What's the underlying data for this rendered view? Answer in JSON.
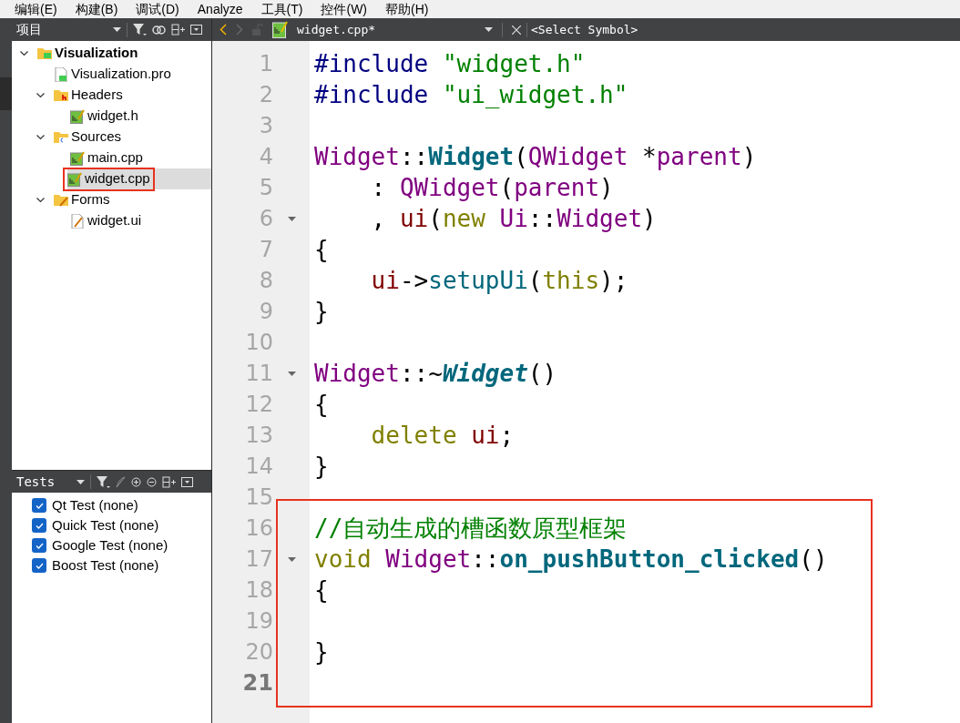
{
  "menu": [
    "编辑(E)",
    "构建(B)",
    "调试(D)",
    "Analyze",
    "工具(T)",
    "控件(W)",
    "帮助(H)"
  ],
  "project_panel": {
    "title": "项目",
    "tree": [
      {
        "label": "Visualization",
        "kind": "project",
        "expanded": true,
        "selected": false,
        "highlighted": false,
        "children": [
          {
            "label": "Visualization.pro",
            "kind": "pro",
            "selected": false,
            "highlighted": false
          },
          {
            "label": "Headers",
            "kind": "headers",
            "expanded": true,
            "selected": false,
            "highlighted": false,
            "children": [
              {
                "label": "widget.h",
                "kind": "source",
                "selected": false,
                "highlighted": false
              }
            ]
          },
          {
            "label": "Sources",
            "kind": "sources",
            "expanded": true,
            "selected": false,
            "highlighted": false,
            "children": [
              {
                "label": "main.cpp",
                "kind": "source",
                "selected": false,
                "highlighted": false
              },
              {
                "label": "widget.cpp",
                "kind": "source",
                "selected": true,
                "highlighted": true
              }
            ]
          },
          {
            "label": "Forms",
            "kind": "forms",
            "expanded": true,
            "selected": false,
            "highlighted": false,
            "children": [
              {
                "label": "widget.ui",
                "kind": "ui",
                "selected": false,
                "highlighted": false
              }
            ]
          }
        ]
      }
    ]
  },
  "tests_panel": {
    "title": "Tests",
    "items": [
      {
        "label": "Qt Test (none)",
        "checked": true
      },
      {
        "label": "Quick Test (none)",
        "checked": true
      },
      {
        "label": "Google Test (none)",
        "checked": true
      },
      {
        "label": "Boost Test (none)",
        "checked": true
      }
    ]
  },
  "editor": {
    "file_tab": "widget.cpp*",
    "symbol": "<Select Symbol>",
    "blocks": [
      {
        "highlighted": false,
        "lines": [
          {
            "number": "1",
            "foldable": false,
            "current": false,
            "tokens": [
              {
                "kind": "preproc",
                "text": "#include "
              },
              {
                "kind": "string",
                "text": "\"widget.h\""
              }
            ]
          },
          {
            "number": "2",
            "foldable": false,
            "current": false,
            "tokens": [
              {
                "kind": "preproc",
                "text": "#include "
              },
              {
                "kind": "string",
                "text": "\"ui_widget.h\""
              }
            ]
          },
          {
            "number": "3",
            "foldable": false,
            "current": false
          },
          {
            "number": "4",
            "foldable": false,
            "current": false,
            "tokens": [
              {
                "kind": "type",
                "text": "Widget"
              },
              {
                "kind": "plain",
                "text": "::"
              },
              {
                "kind": "decl",
                "text": "Widget"
              },
              {
                "kind": "plain",
                "text": "("
              },
              {
                "kind": "type",
                "text": "QWidget"
              },
              {
                "kind": "plain",
                "text": " *"
              },
              {
                "kind": "param",
                "text": "parent"
              },
              {
                "kind": "plain",
                "text": ")"
              }
            ]
          },
          {
            "number": "5",
            "foldable": false,
            "current": false,
            "tokens": [
              {
                "kind": "plain",
                "text": "    : "
              },
              {
                "kind": "type",
                "text": "QWidget"
              },
              {
                "kind": "plain",
                "text": "("
              },
              {
                "kind": "param",
                "text": "parent"
              },
              {
                "kind": "plain",
                "text": ")"
              }
            ]
          },
          {
            "number": "6",
            "foldable": true,
            "current": false,
            "tokens": [
              {
                "kind": "plain",
                "text": "    , "
              },
              {
                "kind": "field",
                "text": "ui"
              },
              {
                "kind": "plain",
                "text": "("
              },
              {
                "kind": "keyword",
                "text": "new "
              },
              {
                "kind": "type",
                "text": "Ui"
              },
              {
                "kind": "plain",
                "text": "::"
              },
              {
                "kind": "type",
                "text": "Widget"
              },
              {
                "kind": "plain",
                "text": ")"
              }
            ]
          },
          {
            "number": "7",
            "foldable": false,
            "current": false,
            "tokens": [
              {
                "kind": "plain",
                "text": "{"
              }
            ]
          },
          {
            "number": "8",
            "foldable": false,
            "current": false,
            "tokens": [
              {
                "kind": "field",
                "text": "    ui"
              },
              {
                "kind": "plain",
                "text": "->"
              },
              {
                "kind": "func",
                "text": "setupUi"
              },
              {
                "kind": "plain",
                "text": "("
              },
              {
                "kind": "keyword",
                "text": "this"
              },
              {
                "kind": "plain",
                "text": ");"
              }
            ]
          },
          {
            "number": "9",
            "foldable": false,
            "current": false,
            "tokens": [
              {
                "kind": "plain",
                "text": "}"
              }
            ]
          },
          {
            "number": "10",
            "foldable": false,
            "current": false
          },
          {
            "number": "11",
            "foldable": true,
            "current": false,
            "tokens": [
              {
                "kind": "type",
                "text": "Widget"
              },
              {
                "kind": "plain",
                "text": "::~"
              },
              {
                "kind": "virtual_decl",
                "text": "Widget"
              },
              {
                "kind": "plain",
                "text": "()"
              }
            ]
          },
          {
            "number": "12",
            "foldable": false,
            "current": false,
            "tokens": [
              {
                "kind": "plain",
                "text": "{"
              }
            ]
          },
          {
            "number": "13",
            "foldable": false,
            "current": false,
            "tokens": [
              {
                "kind": "keyword",
                "text": "    delete "
              },
              {
                "kind": "field",
                "text": "ui"
              },
              {
                "kind": "plain",
                "text": ";"
              }
            ]
          },
          {
            "number": "14",
            "foldable": false,
            "current": false,
            "tokens": [
              {
                "kind": "plain",
                "text": "}"
              }
            ]
          },
          {
            "number": "15",
            "foldable": false,
            "current": false
          }
        ]
      },
      {
        "highlighted": true,
        "lines": [
          {
            "number": "16",
            "foldable": false,
            "current": false,
            "tokens": [
              {
                "kind": "comment",
                "text": "//自动生成的槽函数原型框架"
              }
            ]
          },
          {
            "number": "17",
            "foldable": true,
            "current": false,
            "tokens": [
              {
                "kind": "keyword",
                "text": "void "
              },
              {
                "kind": "type",
                "text": "Widget"
              },
              {
                "kind": "plain",
                "text": "::"
              },
              {
                "kind": "decl",
                "text": "on_pushButton_clicked"
              },
              {
                "kind": "plain",
                "text": "()"
              }
            ]
          },
          {
            "number": "18",
            "foldable": false,
            "current": false,
            "tokens": [
              {
                "kind": "plain",
                "text": "{"
              }
            ]
          },
          {
            "number": "19",
            "foldable": false,
            "current": false
          },
          {
            "number": "20",
            "foldable": false,
            "current": false,
            "tokens": [
              {
                "kind": "plain",
                "text": "}"
              }
            ]
          },
          {
            "number": "21",
            "foldable": false,
            "current": true
          }
        ]
      }
    ]
  }
}
